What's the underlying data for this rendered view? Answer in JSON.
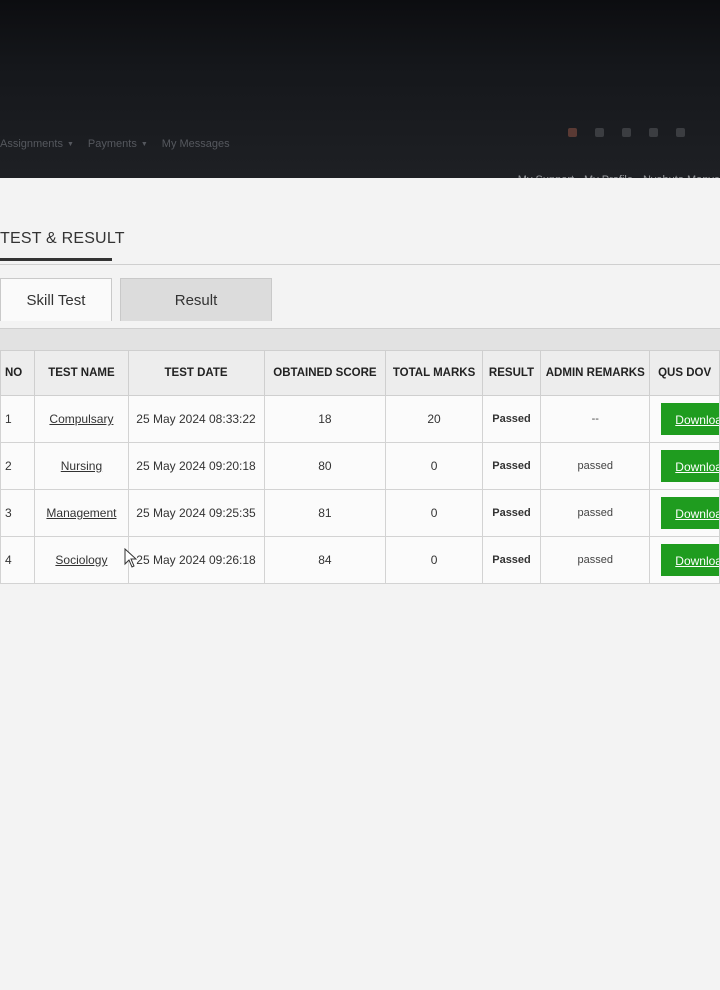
{
  "nav": {
    "items": [
      {
        "label": "Assignments",
        "has_caret": true
      },
      {
        "label": "Payments",
        "has_caret": true
      },
      {
        "label": "My Messages",
        "has_caret": false
      }
    ]
  },
  "userbar": {
    "support": "My Support",
    "profile": "My Profile",
    "user": "Nyabuto Manye"
  },
  "page": {
    "title": "TEST & RESULT"
  },
  "tabs": [
    {
      "label": "Skill Test",
      "active": true
    },
    {
      "label": "Result",
      "active": false
    }
  ],
  "table": {
    "headers": [
      "NO",
      "TEST NAME",
      "TEST DATE",
      "OBTAINED SCORE",
      "TOTAL MARKS",
      "RESULT",
      "ADMIN REMARKS",
      "QUS DOV"
    ],
    "rows": [
      {
        "no": "1",
        "name": "Compulsary",
        "date": "25 May 2024 08:33:22",
        "score": "18",
        "total": "20",
        "result": "Passed",
        "remarks": "--",
        "action": "Downloa"
      },
      {
        "no": "2",
        "name": "Nursing",
        "date": "25 May 2024 09:20:18",
        "score": "80",
        "total": "0",
        "result": "Passed",
        "remarks": "passed",
        "action": "Downloa"
      },
      {
        "no": "3",
        "name": "Management",
        "date": "25 May 2024 09:25:35",
        "score": "81",
        "total": "0",
        "result": "Passed",
        "remarks": "passed",
        "action": "Downloa"
      },
      {
        "no": "4",
        "name": "Sociology",
        "date": "25 May 2024 09:26:18",
        "score": "84",
        "total": "0",
        "result": "Passed",
        "remarks": "passed",
        "action": "Downloa"
      }
    ]
  },
  "colors": {
    "header_bg": "#15171b",
    "download_btn": "#1f9c1f"
  }
}
